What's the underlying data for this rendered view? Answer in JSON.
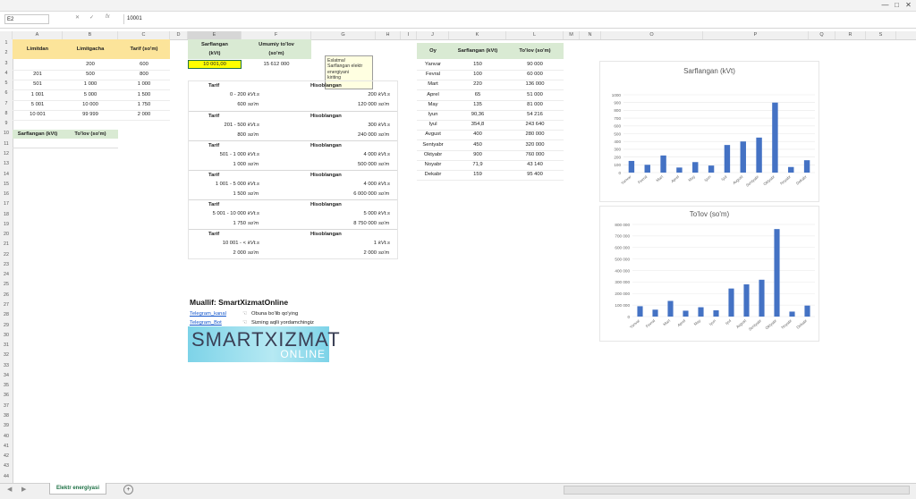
{
  "window": {
    "buttons": [
      "—",
      "□",
      "✕"
    ]
  },
  "formula_bar": {
    "name_box": "E2",
    "value": "10001"
  },
  "columns": [
    "A",
    "B",
    "C",
    "D",
    "E",
    "F",
    "G",
    "H",
    "I",
    "J",
    "K",
    "L",
    "M",
    "N",
    "O",
    "P",
    "Q",
    "R",
    "S"
  ],
  "rows": [
    "1",
    "2",
    "3",
    "4",
    "5",
    "6",
    "7",
    "8",
    "9",
    "10",
    "11",
    "12",
    "13",
    "14",
    "15",
    "16",
    "17",
    "18",
    "19",
    "20",
    "21",
    "22",
    "23",
    "24",
    "25",
    "26",
    "27",
    "28",
    "29",
    "30",
    "31",
    "32",
    "33",
    "34",
    "35",
    "36",
    "37",
    "38",
    "39",
    "40",
    "41",
    "42",
    "43",
    "44"
  ],
  "tariff_table": {
    "headers": [
      "Limitdan",
      "Limitgacha",
      "Tarif (so'm)"
    ],
    "rows": [
      [
        "",
        "200",
        "600"
      ],
      [
        "201",
        "500",
        "800"
      ],
      [
        "501",
        "1 000",
        "1 000"
      ],
      [
        "1 001",
        "5 000",
        "1 500"
      ],
      [
        "5 001",
        "10 000",
        "1 750"
      ],
      [
        "10 001",
        "99 999",
        "2 000"
      ]
    ]
  },
  "small_table": {
    "headers": [
      "Sarflangan (kVt)",
      "To'lov (so'm)"
    ]
  },
  "summary": {
    "h1a": "Sarflangan",
    "h1b": "(kVt)",
    "h2a": "Umumiy to'lov",
    "h2b": "(so'm)",
    "v1": "10 001,00",
    "v2": "15 612 000"
  },
  "note": {
    "lines": [
      "Eslatma!",
      "Sarflangan elektr",
      "energiyani",
      "kiriting"
    ]
  },
  "calc": {
    "tarif_label": "Tarif",
    "hisob_label": "Hisoblangan",
    "blocks": [
      {
        "range": "0 - 200",
        "unit": "kVt.s",
        "price": "600",
        "punit": "so'm",
        "h1": "200",
        "h1u": "kVt.s",
        "h2": "120 000",
        "h2u": "so'm"
      },
      {
        "range": "201 - 500",
        "unit": "kVt.s",
        "price": "800",
        "punit": "so'm",
        "h1": "300",
        "h1u": "kVt.s",
        "h2": "240 000",
        "h2u": "so'm"
      },
      {
        "range": "501 - 1 000",
        "unit": "kVt.s",
        "price": "1 000",
        "punit": "so'm",
        "h1": "4 000",
        "h1u": "kVt.s",
        "h2": "500 000",
        "h2u": "so'm"
      },
      {
        "range": "1 001 - 5 000",
        "unit": "kVt.s",
        "price": "1 500",
        "punit": "so'm",
        "h1": "4 000",
        "h1u": "kVt.s",
        "h2": "6 000 000",
        "h2u": "so'm"
      },
      {
        "range": "5 001 - 10 000",
        "unit": "kVt.s",
        "price": "1 750",
        "punit": "so'm",
        "h1": "5 000",
        "h1u": "kVt.s",
        "h2": "8 750 000",
        "h2u": "so'm"
      },
      {
        "range": "10 001 - <",
        "unit": "kVt.s",
        "price": "2 000",
        "punit": "so'm",
        "h1": "1",
        "h1u": "kVt.s",
        "h2": "2 000",
        "h2u": "so'm"
      }
    ]
  },
  "author": {
    "title": "Muallif: SmartXizmatOnline",
    "link1": "Telegram_kanal",
    "text1": "Obuna bo'lib qo'ying",
    "link2": "Telegram_Bot",
    "text2": "Sizning aqlli yordamchingiz",
    "logo1": "SMARTXIZMAT",
    "logo2": "ONLINE"
  },
  "monthly": {
    "headers": [
      "Oy",
      "Sarflangan (kVt)",
      "To'lov (so'm)"
    ],
    "rows": [
      [
        "Yanvar",
        "150",
        "90 000"
      ],
      [
        "Fevral",
        "100",
        "60 000"
      ],
      [
        "Mart",
        "220",
        "136 000"
      ],
      [
        "Aprel",
        "65",
        "51 000"
      ],
      [
        "May",
        "135",
        "81 000"
      ],
      [
        "Iyun",
        "90,36",
        "54 216"
      ],
      [
        "Iyul",
        "354,8",
        "243 640"
      ],
      [
        "Avgust",
        "400",
        "280 000"
      ],
      [
        "Sentyabr",
        "450",
        "320 000"
      ],
      [
        "Oktyabr",
        "900",
        "760 000"
      ],
      [
        "Noyabr",
        "71,9",
        "43 140"
      ],
      [
        "Dekabr",
        "159",
        "95 400"
      ]
    ]
  },
  "sheet_tab": "Elektr energiyasi",
  "add_sheet": "+",
  "colors": {
    "bar": "#4472c4",
    "yellow": "#fce49a",
    "green": "#d9ead3",
    "highlight": "#ffff00"
  },
  "chart_data": [
    {
      "type": "bar",
      "title": "Sarflangan (kVt)",
      "categories": [
        "Yanvar",
        "Fevral",
        "Mart",
        "Aprel",
        "May",
        "Iyun",
        "Iyul",
        "Avgust",
        "Sentyabr",
        "Oktyabr",
        "Noyabr",
        "Dekabr"
      ],
      "values": [
        150,
        100,
        220,
        65,
        135,
        90.36,
        354.8,
        400,
        450,
        900,
        71.9,
        159
      ],
      "yticks": [
        "0",
        "100",
        "200",
        "300",
        "400",
        "500",
        "600",
        "700",
        "800",
        "900",
        "1000"
      ],
      "ylim": [
        0,
        1000
      ]
    },
    {
      "type": "bar",
      "title": "To'lov (so'm)",
      "categories": [
        "Yanvar",
        "Fevral",
        "Mart",
        "Aprel",
        "May",
        "Iyun",
        "Iyul",
        "Avgust",
        "Sentyabr",
        "Oktyabr",
        "Noyabr",
        "Dekabr"
      ],
      "values": [
        90000,
        60000,
        136000,
        51000,
        81000,
        54216,
        243640,
        280000,
        320000,
        760000,
        43140,
        95400
      ],
      "yticks": [
        "0",
        "100 000",
        "200 000",
        "300 000",
        "400 000",
        "500 000",
        "600 000",
        "700 000",
        "800 000"
      ],
      "ylim": [
        0,
        800000
      ]
    }
  ]
}
